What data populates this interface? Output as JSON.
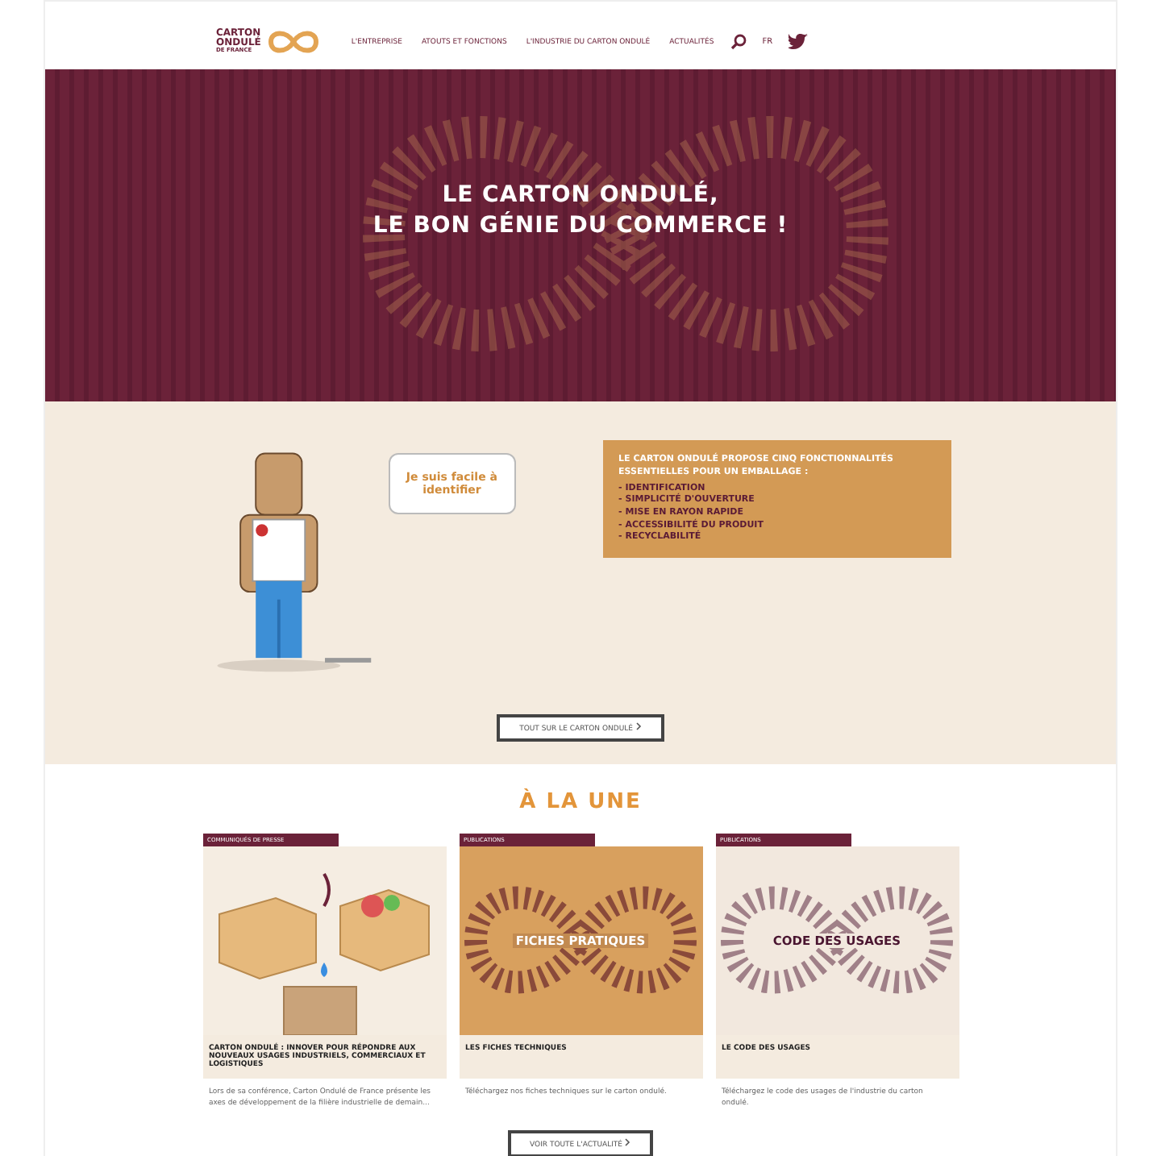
{
  "header": {
    "logo_lines": [
      "CARTON",
      "ONDULÉ",
      "DE FRANCE"
    ],
    "nav": [
      "L'ENTREPRISE",
      "ATOUTS ET FONCTIONS",
      "L'INDUSTRIE DU CARTON ONDULÉ",
      "ACTUALITÉS"
    ],
    "language": "FR"
  },
  "hero": {
    "title_lines": [
      "LE CARTON ONDULÉ,",
      "LE BON GÉNIE DU COMMERCE !"
    ]
  },
  "features": {
    "speech": "Je suis facile à identifier",
    "intro": "LE CARTON ONDULÉ PROPOSE CINQ FONCTIONNALITÉS ESSENTIELLES POUR UN EMBALLAGE :",
    "items": [
      "- IDENTIFICATION",
      "- SIMPLICITÉ D'OUVERTURE",
      "- MISE EN RAYON RAPIDE",
      "- ACCESSIBILITÉ DU PRODUIT",
      "- RECYCLABILITÉ"
    ],
    "button": "TOUT SUR LE CARTON ONDULÉ"
  },
  "news": {
    "heading": "À LA UNE",
    "cards": [
      {
        "kind": "boxes",
        "tag": "COMMUNIQUÉS DE PRESSE",
        "title": "CARTON ONDULÉ : INNOVER POUR RÉPONDRE AUX NOUVEAUX USAGES INDUSTRIELS, COMMERCIAUX ET LOGISTIQUES",
        "summary": "Lors de sa conférence, Carton Ondulé de France présente les axes de développement de la filière industrielle de demain..."
      },
      {
        "kind": "loop",
        "tag": "PUBLICATIONS",
        "overlay": "FICHES PRATIQUES",
        "title": "LES FICHES TECHNIQUES",
        "summary": "Téléchargez nos fiches techniques sur le carton ondulé."
      },
      {
        "kind": "plain-loop",
        "tag": "PUBLICATIONS",
        "overlay": "CODE DES USAGES",
        "title": "LE CODE DES USAGES",
        "summary": "Téléchargez le code des usages de l'industrie du carton ondulé."
      }
    ],
    "button": "VOIR TOUTE L'ACTUALITÉ"
  }
}
